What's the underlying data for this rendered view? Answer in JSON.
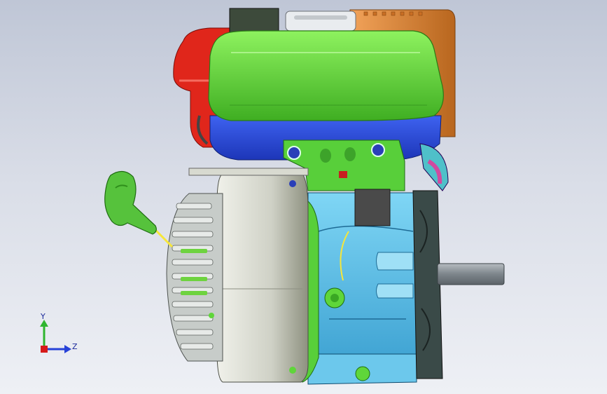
{
  "viewport": {
    "background_top": "#bfc6d6",
    "background_bottom": "#eef0f5"
  },
  "model": {
    "parts": {
      "fuel_tank_top": "#5fd63a",
      "fuel_tank_bottom": "#2f50e0",
      "air_filter": "#e0261b",
      "muffler_cover": "#e28a34",
      "flywheel_cover": "#d7d9ce",
      "fan_shroud": "#c7ccc9",
      "crankcase": "#58bfe8",
      "recoil_handle": "#56c23c",
      "mount_plate": "#58cf3a",
      "control_box": "#4a4a4a",
      "output_shaft": "#8e979e",
      "pull_rope": "#f6e63a"
    }
  },
  "triad": {
    "y_label": "Y",
    "z_label": "Z",
    "y_color": "#2fb52f",
    "z_color": "#2742d8",
    "x_color": "#d61a1a"
  }
}
